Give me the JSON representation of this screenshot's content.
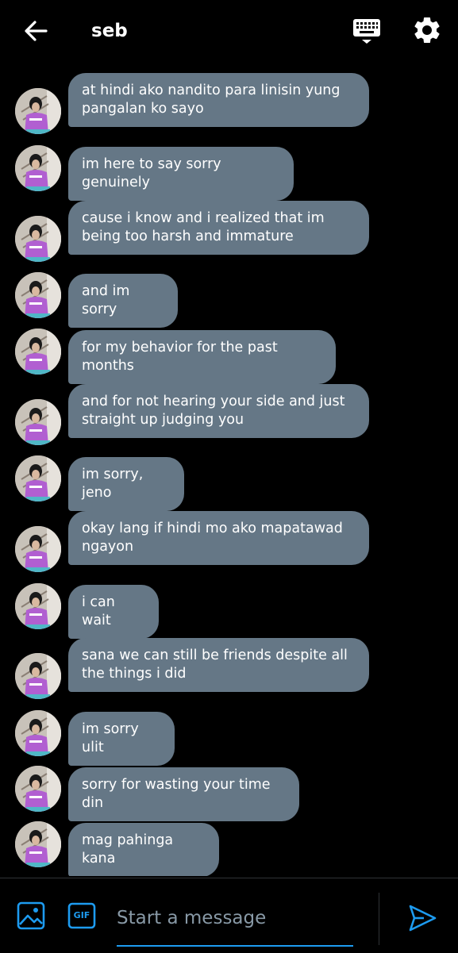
{
  "header": {
    "title": "seb",
    "back_icon": "arrow-left-icon",
    "keyboard_icon": "keyboard-icon",
    "settings_icon": "gear-icon"
  },
  "messages": [
    {
      "text": "at hindi ako nandito para linisin yung pangalan ko sayo"
    },
    {
      "text": "im here to say sorry genuinely"
    },
    {
      "text": "cause i know and i realized that im being too harsh and immature"
    },
    {
      "text": "and im sorry"
    },
    {
      "text": "for my behavior for the past months"
    },
    {
      "text": "and for not hearing your side and just straight up judging you"
    },
    {
      "text": "im sorry, jeno"
    },
    {
      "text": "okay lang if hindi mo ako mapatawad ngayon"
    },
    {
      "text": "i can wait"
    },
    {
      "text": "sana we can still be friends despite all the things i did"
    },
    {
      "text": "im sorry ulit"
    },
    {
      "text": "sorry for wasting your time din"
    },
    {
      "text": "mag pahinga kana"
    }
  ],
  "composer": {
    "placeholder": "Start a message",
    "gif_label": "GIF",
    "image_icon": "image-icon",
    "send_icon": "send-icon"
  },
  "colors": {
    "background": "#000000",
    "bubble": "#657786",
    "accent": "#1d9bf0",
    "placeholder": "#8899a6"
  }
}
